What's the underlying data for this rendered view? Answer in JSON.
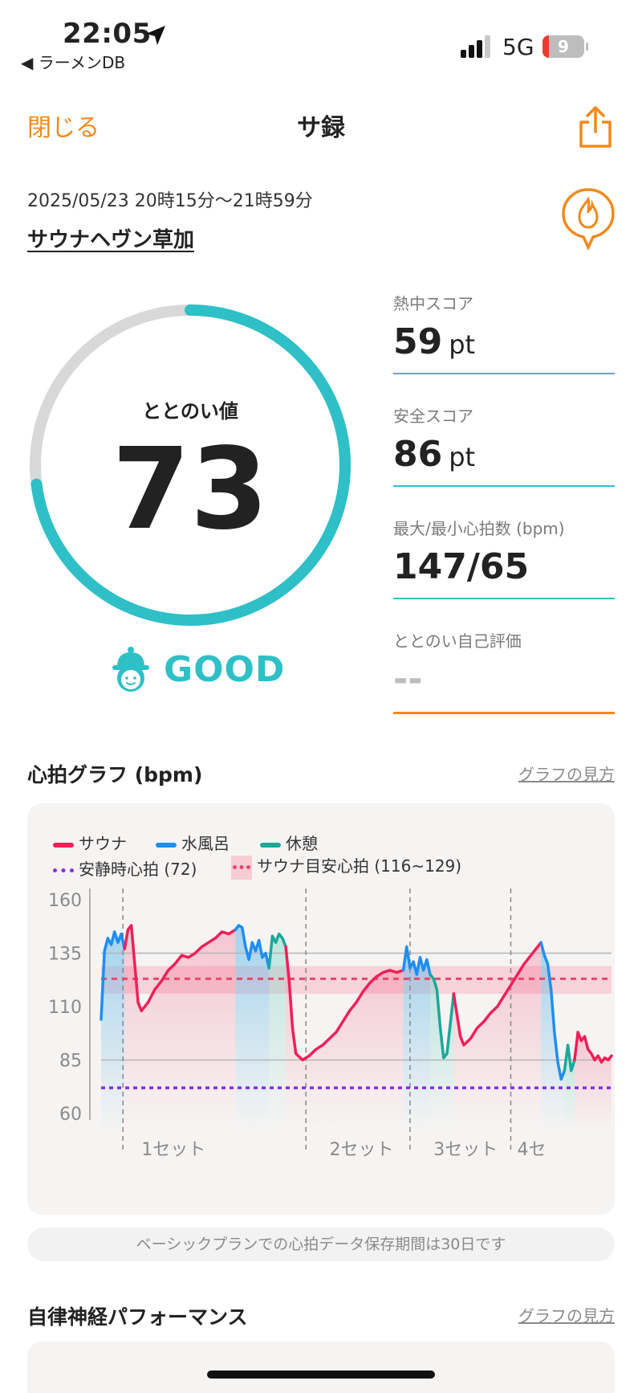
{
  "status_bar": {
    "time": "22:05",
    "back_app": "◀ ラーメンDB",
    "network": "5G",
    "battery": "9"
  },
  "nav": {
    "close": "閉じる",
    "title": "サ録"
  },
  "session": {
    "date_range": "2025/05/23 20時15分〜21時59分",
    "venue": "サウナヘヴン草加"
  },
  "totonoi": {
    "label": "ととのい値",
    "value": "73",
    "score_fraction": 0.73,
    "grade": "GOOD"
  },
  "metrics": [
    {
      "label": "熱中スコア",
      "value": "59",
      "unit": "pt"
    },
    {
      "label": "安全スコア",
      "value": "86",
      "unit": "pt"
    },
    {
      "label": "最大/最小心拍数 (bpm)",
      "value": "147/65",
      "unit": ""
    },
    {
      "label": "ととのい自己評価",
      "value": "--",
      "unit": ""
    }
  ],
  "heart_section": {
    "title": "心拍グラフ (bpm)",
    "how_to": "グラフの見方"
  },
  "colors": {
    "sauna": "#ef1f58",
    "water": "#1f8ef1",
    "rest": "#1aa89a",
    "resting_hr": "#8a2be2",
    "target": "#e8466b",
    "accent": "#f0891c",
    "teal": "#2ec0c6"
  },
  "chart_data": {
    "type": "line",
    "title": "",
    "xlabel": "",
    "ylabel": "",
    "ylim": [
      60,
      160
    ],
    "yticks": [
      160,
      135,
      110,
      85,
      60
    ],
    "legend": [
      "サウナ",
      "水風呂",
      "休憩",
      "安静時心拍 (72)",
      "サウナ目安心拍 (116~129)"
    ],
    "resting_hr": 72,
    "target_range": [
      116,
      129
    ],
    "target_mid": 123,
    "x_range": [
      0,
      100
    ],
    "set_boundaries": [
      6.5,
      61,
      92
    ],
    "set_labels": [
      {
        "label": "1セット",
        "x": 12
      },
      {
        "label": "2セット",
        "x": 68
      },
      {
        "label": "3セット",
        "x": 99
      },
      {
        "label": "4セ",
        "x": 1000
      }
    ],
    "x_ticks": [
      6.5,
      61,
      92,
      122
    ],
    "segments": [
      {
        "kind": "water",
        "x": [
          0,
          1,
          2,
          3,
          4,
          5,
          6,
          7
        ],
        "y": [
          104,
          136,
          142,
          139,
          145,
          140,
          144,
          137
        ]
      },
      {
        "kind": "sauna",
        "x": [
          7,
          8,
          9,
          10,
          11,
          12,
          14,
          16,
          18,
          20,
          22,
          24,
          26,
          28,
          30,
          32,
          34,
          36,
          38,
          40
        ],
        "y": [
          137,
          146,
          148,
          130,
          112,
          108,
          112,
          118,
          122,
          127,
          130,
          134,
          133,
          135,
          138,
          140,
          142,
          145,
          144,
          146
        ]
      },
      {
        "kind": "water",
        "x": [
          40,
          41,
          42,
          43,
          44,
          45,
          46,
          47,
          48,
          49,
          50
        ],
        "y": [
          146,
          148,
          147,
          138,
          132,
          140,
          136,
          141,
          133,
          135,
          128
        ]
      },
      {
        "kind": "rest",
        "x": [
          50,
          51,
          52,
          53,
          54,
          55
        ],
        "y": [
          128,
          143,
          140,
          144,
          142,
          138
        ]
      },
      {
        "kind": "sauna",
        "x": [
          55,
          56,
          57,
          58,
          60,
          62,
          64,
          66,
          68,
          70,
          72,
          74,
          76,
          78,
          80,
          82,
          84,
          86,
          88,
          90
        ],
        "y": [
          138,
          122,
          100,
          88,
          85,
          87,
          90,
          92,
          95,
          98,
          103,
          108,
          112,
          117,
          121,
          124,
          126,
          127,
          126,
          127
        ]
      },
      {
        "kind": "water",
        "x": [
          90,
          91,
          92,
          93,
          94,
          95,
          96,
          97,
          98
        ],
        "y": [
          127,
          138,
          128,
          131,
          125,
          133,
          127,
          132,
          125
        ]
      },
      {
        "kind": "rest",
        "x": [
          98,
          99,
          100,
          101,
          102,
          103,
          104,
          105
        ],
        "y": [
          125,
          123,
          118,
          100,
          86,
          88,
          102,
          116
        ]
      },
      {
        "kind": "sauna",
        "x": [
          105,
          106,
          107,
          108,
          110,
          112,
          114,
          116,
          118,
          120,
          122,
          124,
          126,
          128,
          130,
          131
        ],
        "y": [
          116,
          106,
          96,
          92,
          95,
          100,
          103,
          107,
          110,
          115,
          120,
          125,
          130,
          134,
          138,
          140
        ]
      },
      {
        "kind": "water",
        "x": [
          131,
          132,
          133,
          134,
          135,
          136,
          137,
          138
        ],
        "y": [
          140,
          134,
          130,
          118,
          98,
          84,
          76,
          80
        ]
      },
      {
        "kind": "rest",
        "x": [
          138,
          139,
          140,
          141
        ],
        "y": [
          80,
          92,
          80,
          85
        ]
      },
      {
        "kind": "sauna",
        "x": [
          141,
          142,
          143,
          144,
          145,
          146,
          147,
          148,
          149,
          150,
          151,
          152
        ],
        "y": [
          85,
          98,
          94,
          96,
          90,
          88,
          85,
          87,
          84,
          86,
          85,
          87
        ]
      }
    ]
  },
  "footer": {
    "notice": "ベーシックプランでの心拍データ保存期間は30日です",
    "perf_title": "自律神経パフォーマンス",
    "perf_how_to": "グラフの見方"
  }
}
